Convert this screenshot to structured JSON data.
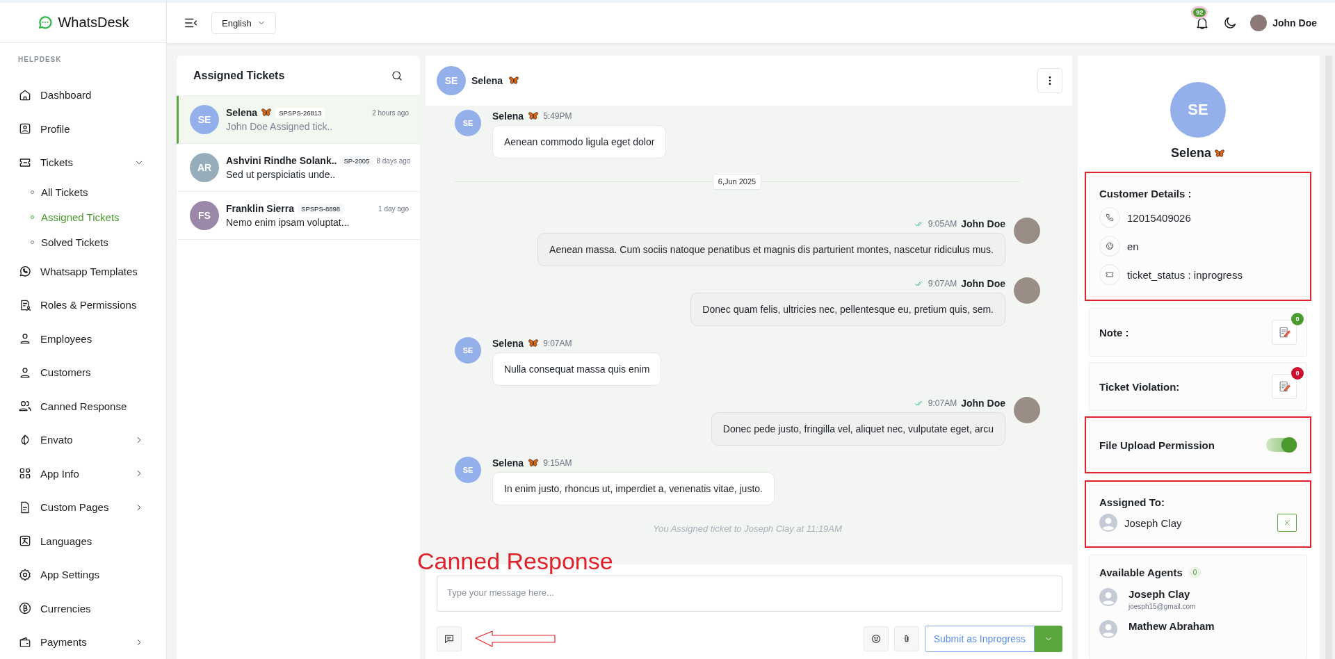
{
  "brand": {
    "name": "WhatsDesk"
  },
  "topbar": {
    "language": "English",
    "notifications": "92",
    "user": "John Doe"
  },
  "sidebar": {
    "section": "HELPDESK",
    "items": [
      {
        "label": "Dashboard",
        "selected": false
      },
      {
        "label": "Profile",
        "selected": false
      },
      {
        "label": "Tickets",
        "selected": false,
        "expanded": true,
        "children": [
          {
            "label": "All Tickets",
            "selected": false
          },
          {
            "label": "Assigned Tickets",
            "selected": true
          },
          {
            "label": "Solved Tickets",
            "selected": false
          }
        ]
      },
      {
        "label": "Whatsapp Templates",
        "selected": false
      },
      {
        "label": "Roles & Permissions",
        "selected": false
      },
      {
        "label": "Employees",
        "selected": false
      },
      {
        "label": "Customers",
        "selected": false
      },
      {
        "label": "Canned Response",
        "selected": false
      },
      {
        "label": "Envato",
        "selected": false,
        "expanded": false
      },
      {
        "label": "App Info",
        "selected": false,
        "expanded": false
      },
      {
        "label": "Custom Pages",
        "selected": false,
        "expanded": false
      },
      {
        "label": "Languages",
        "selected": false
      },
      {
        "label": "App Settings",
        "selected": false
      },
      {
        "label": "Currencies",
        "selected": false
      },
      {
        "label": "Payments",
        "selected": false,
        "expanded": false
      }
    ]
  },
  "tickets": {
    "title": "Assigned Tickets",
    "items": [
      {
        "initials": "SE",
        "color": "#94b0ea",
        "name": "Selena",
        "emoji": true,
        "code": "SPSPS-26813",
        "time": "2 hours ago",
        "preview": "John Doe Assigned tick..",
        "selected": true
      },
      {
        "initials": "AR",
        "color": "#96aebb",
        "name": "Ashvini Rindhe Solank..",
        "emoji": false,
        "code": "SP-2005",
        "time": "8 days ago",
        "preview": "Sed ut perspiciatis unde..",
        "selected": false
      },
      {
        "initials": "FS",
        "color": "#9b87a8",
        "name": "Franklin Sierra",
        "emoji": false,
        "code": "SPSPS-8898",
        "time": "1 day ago",
        "preview": "Nemo enim ipsam voluptat...",
        "selected": false
      }
    ]
  },
  "chat": {
    "initials": "SE",
    "name": "Selena",
    "emoji": true,
    "messages": [
      {
        "kind": "incoming",
        "initials": "SE",
        "sender": "Selena",
        "emoji": true,
        "time": "5:49PM",
        "text": "Aenean commodo ligula eget dolor"
      },
      {
        "kind": "date",
        "text": "6,Jun 2025"
      },
      {
        "kind": "outgoing",
        "sender": "John Doe",
        "time": "9:05AM",
        "text": "Aenean massa. Cum sociis natoque penatibus et magnis dis parturient montes, nascetur ridiculus mus."
      },
      {
        "kind": "outgoing",
        "sender": "John Doe",
        "time": "9:07AM",
        "text": "Donec quam felis, ultricies nec, pellentesque eu, pretium quis, sem."
      },
      {
        "kind": "incoming",
        "initials": "SE",
        "sender": "Selena",
        "emoji": true,
        "time": "9:07AM",
        "text": "Nulla consequat massa quis enim"
      },
      {
        "kind": "outgoing",
        "sender": "John Doe",
        "time": "9:07AM",
        "text": "Donec pede justo, fringilla vel, aliquet nec, vulputate eget, arcu"
      },
      {
        "kind": "incoming",
        "initials": "SE",
        "sender": "Selena",
        "emoji": true,
        "time": "9:15AM",
        "text": "In enim justo, rhoncus ut, imperdiet a, venenatis vitae, justo."
      },
      {
        "kind": "system",
        "text": "You Assigned ticket to Joseph Clay at 11:19AM"
      }
    ],
    "composer": {
      "placeholder": "Type your message here...",
      "submit": "Submit as Inprogress"
    },
    "annotation": {
      "label": "Canned Response"
    }
  },
  "customer": {
    "initials": "SE",
    "name": "Selena",
    "emoji": true,
    "details": {
      "title": "Customer Details :",
      "highlighted": true,
      "rows": [
        "12015409026",
        "en",
        "ticket_status : inprogress"
      ]
    },
    "note": {
      "label": "Note :",
      "count": "0",
      "color": "#4a9a2e",
      "highlighted": false
    },
    "violation": {
      "label": "Ticket Violation:",
      "count": "0",
      "color": "#c8102e",
      "highlighted": false
    },
    "file_upload": {
      "label": "File Upload Permission",
      "on": true,
      "highlighted": true
    },
    "assigned": {
      "label": "Assigned To:",
      "agent": "Joseph Clay",
      "highlighted": true
    },
    "agents": {
      "label": "Available Agents",
      "count": "0",
      "items": [
        {
          "name": "Joseph Clay",
          "email": "joesph15@gmail.com"
        },
        {
          "name": "Mathew Abraham"
        }
      ]
    }
  }
}
